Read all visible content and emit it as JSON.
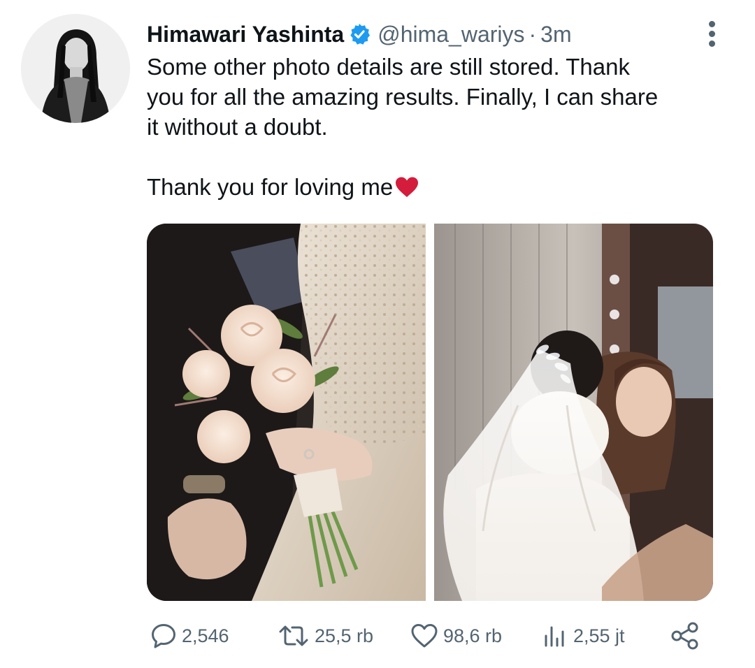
{
  "tweet": {
    "display_name": "Himawari Yashinta",
    "handle": "@hima_wariys",
    "separator": "·",
    "time": "3m",
    "text_lines": [
      "Some other photo details are still stored. Thank",
      "you for all the amazing results. Finally, I can share",
      "it without a doubt."
    ],
    "text_last": "Thank you for loving me"
  },
  "icons": {
    "verified": "verified-badge-icon",
    "more": "more-options-icon",
    "heart_emoji": "red-heart-emoji",
    "reply": "reply-bubble-icon",
    "retweet": "retweet-icon",
    "like": "heart-icon",
    "views": "views-bar-chart-icon",
    "share": "share-icon"
  },
  "stats": {
    "replies": "2,546",
    "retweets": "25,5 rb",
    "likes": "98,6 rb",
    "views": "2,55 jt"
  },
  "colors": {
    "verified_blue": "#1d9bf0",
    "secondary_text": "#536471",
    "primary_text": "#0f1419",
    "heart_red": "#d41c3c"
  }
}
